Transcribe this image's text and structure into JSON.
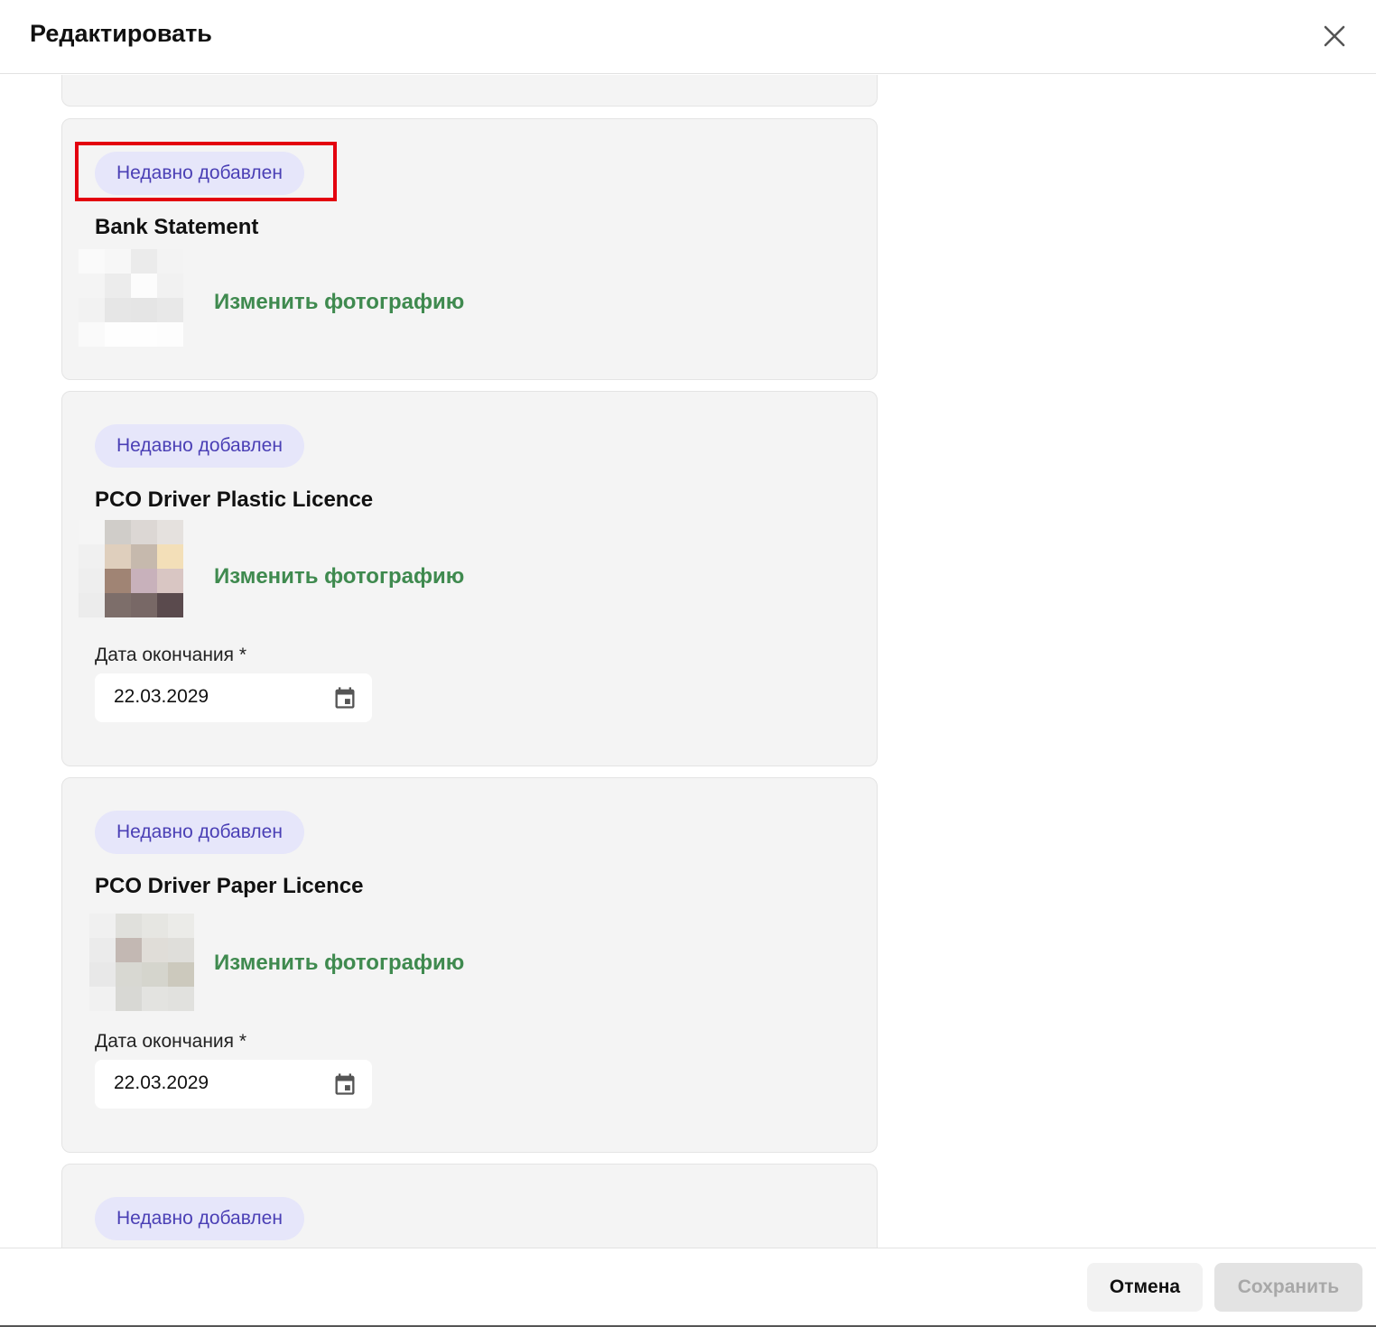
{
  "header": {
    "title": "Редактировать",
    "close_icon": "close-icon"
  },
  "documents": [
    {
      "badge": "Недавно добавлен",
      "title": "Bank Statement",
      "change_photo": "Изменить фотографию",
      "thumb_colors": [
        "#fafafa",
        "#f7f7f7",
        "#ebebeb",
        "#f3f3f3",
        "#f4f4f4",
        "#ececec",
        "#fcfcfc",
        "#f1f1f1",
        "#f2f2f2",
        "#e6e6e6",
        "#e5e5e5",
        "#e8e8e8",
        "#fafafa",
        "#fefefe",
        "#fefefe",
        "#fdfdfd"
      ]
    },
    {
      "badge": "Недавно добавлен",
      "title": "PCO Driver Plastic Licence",
      "change_photo": "Изменить фотографию",
      "thumb_colors": [
        "#f5f5f5",
        "#d0cdc9",
        "#dcd7d4",
        "#e5e1de",
        "#f0f0f0",
        "#dfcfbd",
        "#c6b9ad",
        "#f3dfb8",
        "#eeeeee",
        "#a08474",
        "#c8b1bb",
        "#d9c6c3",
        "#ececec",
        "#7d6e6a",
        "#786866",
        "#5a4a4d"
      ],
      "date_label": "Дата окончания *",
      "date_value": "22.03.2029"
    },
    {
      "badge": "Недавно добавлен",
      "title": "PCO Driver Paper Licence",
      "change_photo": "Изменить фотографию",
      "thumb_colors": [
        "#f0f0f0",
        "#e0e0dc",
        "#e6e6e2",
        "#ebebe8",
        "#ebebeb",
        "#c3b8b3",
        "#e0ddd8",
        "#dfdeda",
        "#e8e8e8",
        "#d8d8d2",
        "#d5d5cd",
        "#ccc9bd",
        "#f1f1f1",
        "#d8d8d4",
        "#e3e3e0",
        "#e1e1de"
      ],
      "date_label": "Дата окончания *",
      "date_value": "22.03.2029"
    },
    {
      "badge": "Недавно добавлен"
    }
  ],
  "footer": {
    "cancel_label": "Отмена",
    "save_label": "Сохранить"
  }
}
